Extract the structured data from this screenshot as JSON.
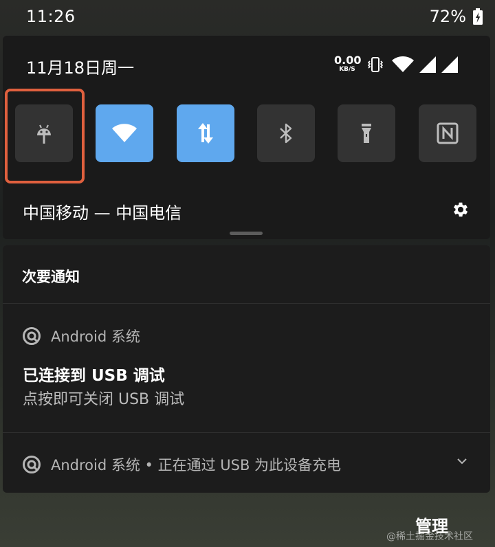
{
  "status_bar": {
    "time": "11:26",
    "battery": "72%"
  },
  "quick_settings": {
    "date": "11月18日周一",
    "net_speed_value": "0.00",
    "net_speed_unit": "KB/S",
    "tiles": [
      {
        "id": "debug",
        "icon": "android-debug-icon",
        "active": false
      },
      {
        "id": "wifi",
        "icon": "wifi-icon",
        "active": true
      },
      {
        "id": "mobile-data",
        "icon": "data-arrows-icon",
        "active": true
      },
      {
        "id": "bluetooth",
        "icon": "bluetooth-icon",
        "active": false
      },
      {
        "id": "flashlight",
        "icon": "flashlight-icon",
        "active": false
      },
      {
        "id": "nfc",
        "icon": "nfc-icon",
        "active": false
      }
    ],
    "carrier": "中国移动 — 中国电信",
    "highlight_color": "#e0603e",
    "tile_active_color": "#5fa8ee"
  },
  "notifications": {
    "section_header": "次要通知",
    "items": [
      {
        "app_name": "Android 系统",
        "title": "已连接到 USB 调试",
        "body": "点按即可关闭 USB 调试"
      },
      {
        "app_name": "Android 系统 • 正在通过 USB 为此设备充电"
      }
    ]
  },
  "footer": {
    "manage_label": "管理",
    "watermark": "@稀土掘金技术社区"
  }
}
